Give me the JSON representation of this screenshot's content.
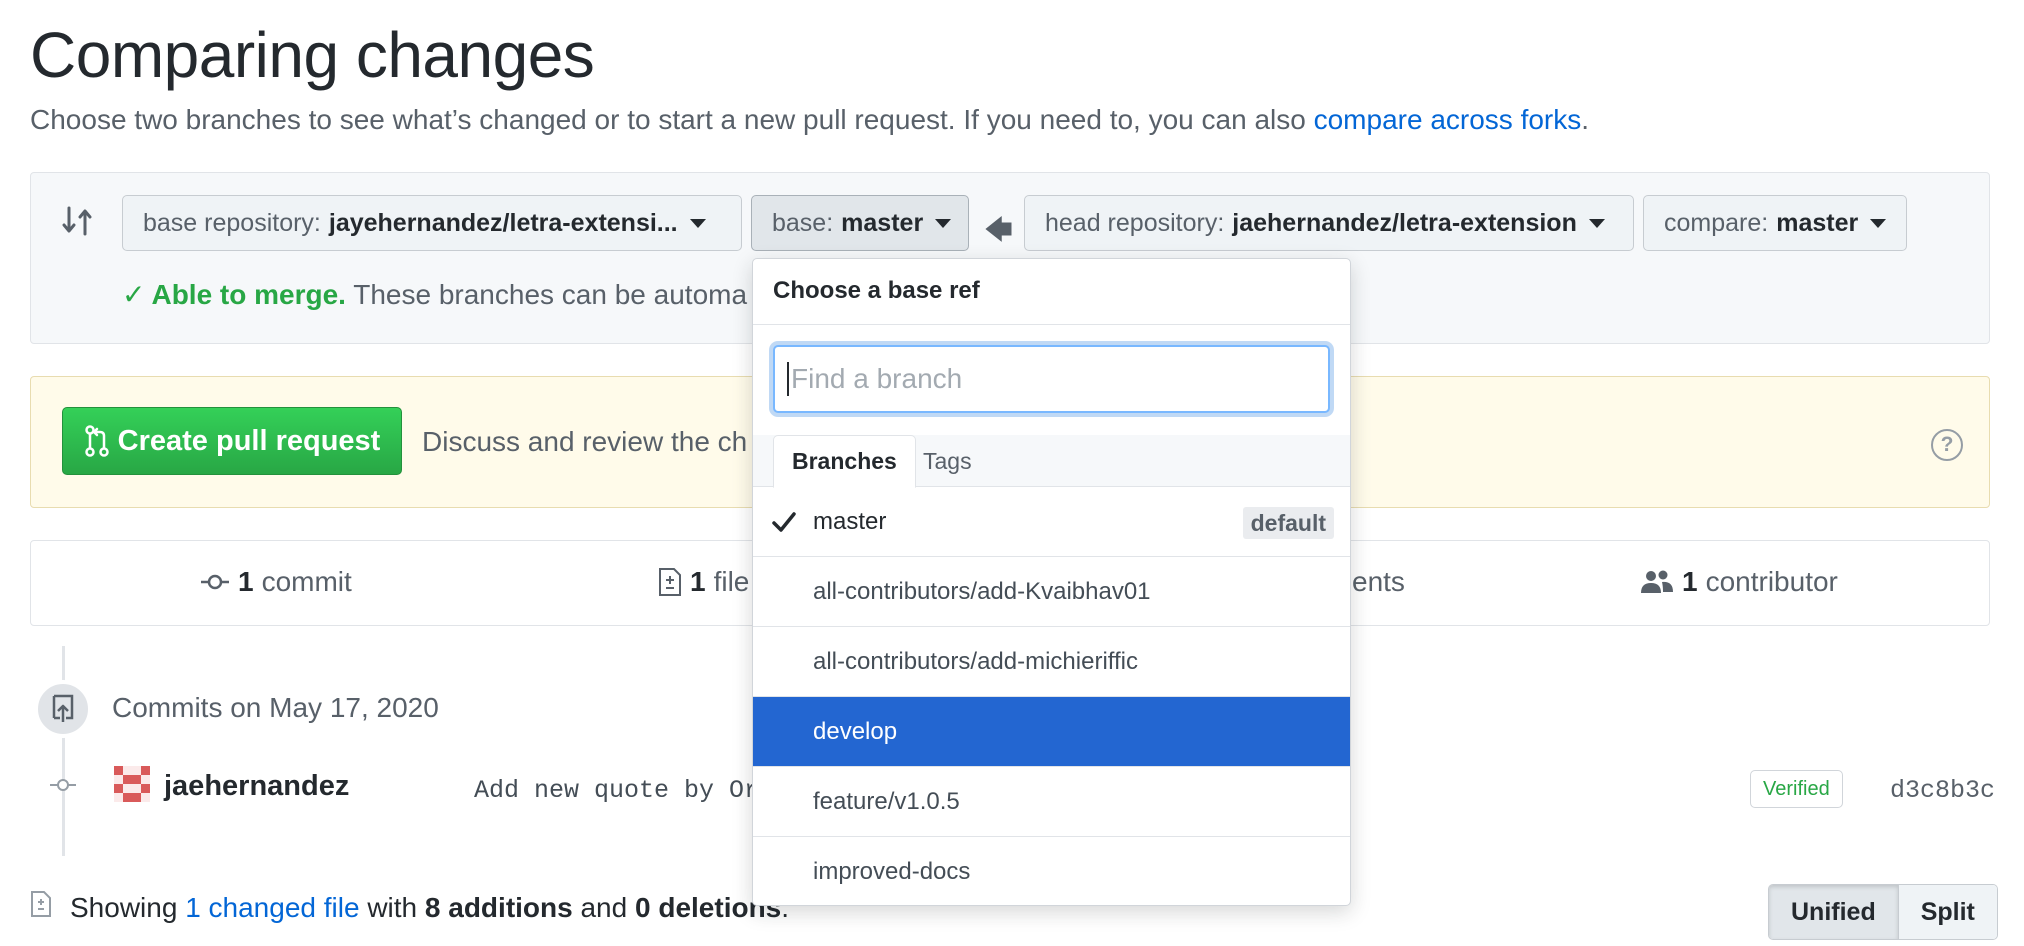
{
  "page": {
    "title": "Comparing changes",
    "subtitle_prefix": "Choose two branches to see what’s changed or to start a new pull request. If you need to, you can also ",
    "subtitle_link": "compare across forks",
    "subtitle_suffix": "."
  },
  "range": {
    "base_repo_label": "base repository:",
    "base_repo_value": "jayehernandez/letra-extensi...",
    "base_label": "base:",
    "base_value": "master",
    "head_repo_label": "head repository:",
    "head_repo_value": "jaehernandez/letra-extension",
    "compare_label": "compare:",
    "compare_value": "master",
    "merge_ok": "Able to merge.",
    "merge_text": "These branches can be automa"
  },
  "pull_request": {
    "button_label": "Create pull request",
    "description": "Discuss and review the ch"
  },
  "stats": {
    "commits_count": "1",
    "commits_label": "commit",
    "files_count": "1",
    "files_label": "file",
    "comments_label": "ents",
    "contributors_count": "1",
    "contributors_label": "contributor"
  },
  "commits": {
    "date_heading": "Commits on May 17, 2020",
    "items": [
      {
        "author": "jaehernandez",
        "message": "Add new quote by Org",
        "verified": "Verified",
        "sha": "d3c8b3c"
      }
    ]
  },
  "summary": {
    "showing": "Showing ",
    "changed_link": "1 changed file",
    "with": " with ",
    "additions": "8 additions",
    "and": " and ",
    "deletions": "0 deletions",
    "end": "."
  },
  "diff_view": {
    "unified": "Unified",
    "split": "Split"
  },
  "dropdown": {
    "header": "Choose a base ref",
    "filter_placeholder": "Find a branch",
    "tabs": [
      "Branches",
      "Tags"
    ],
    "default_badge": "default",
    "branches": [
      {
        "name": "master"
      },
      {
        "name": "all-contributors/add-Kvaibhav01"
      },
      {
        "name": "all-contributors/add-michieriffic"
      },
      {
        "name": "develop"
      },
      {
        "name": "feature/v1.0.5"
      },
      {
        "name": "improved-docs"
      }
    ]
  },
  "colors": {
    "accent_link": "#0366d6",
    "success_green": "#28a745",
    "highlight_blue": "#2366d1"
  }
}
